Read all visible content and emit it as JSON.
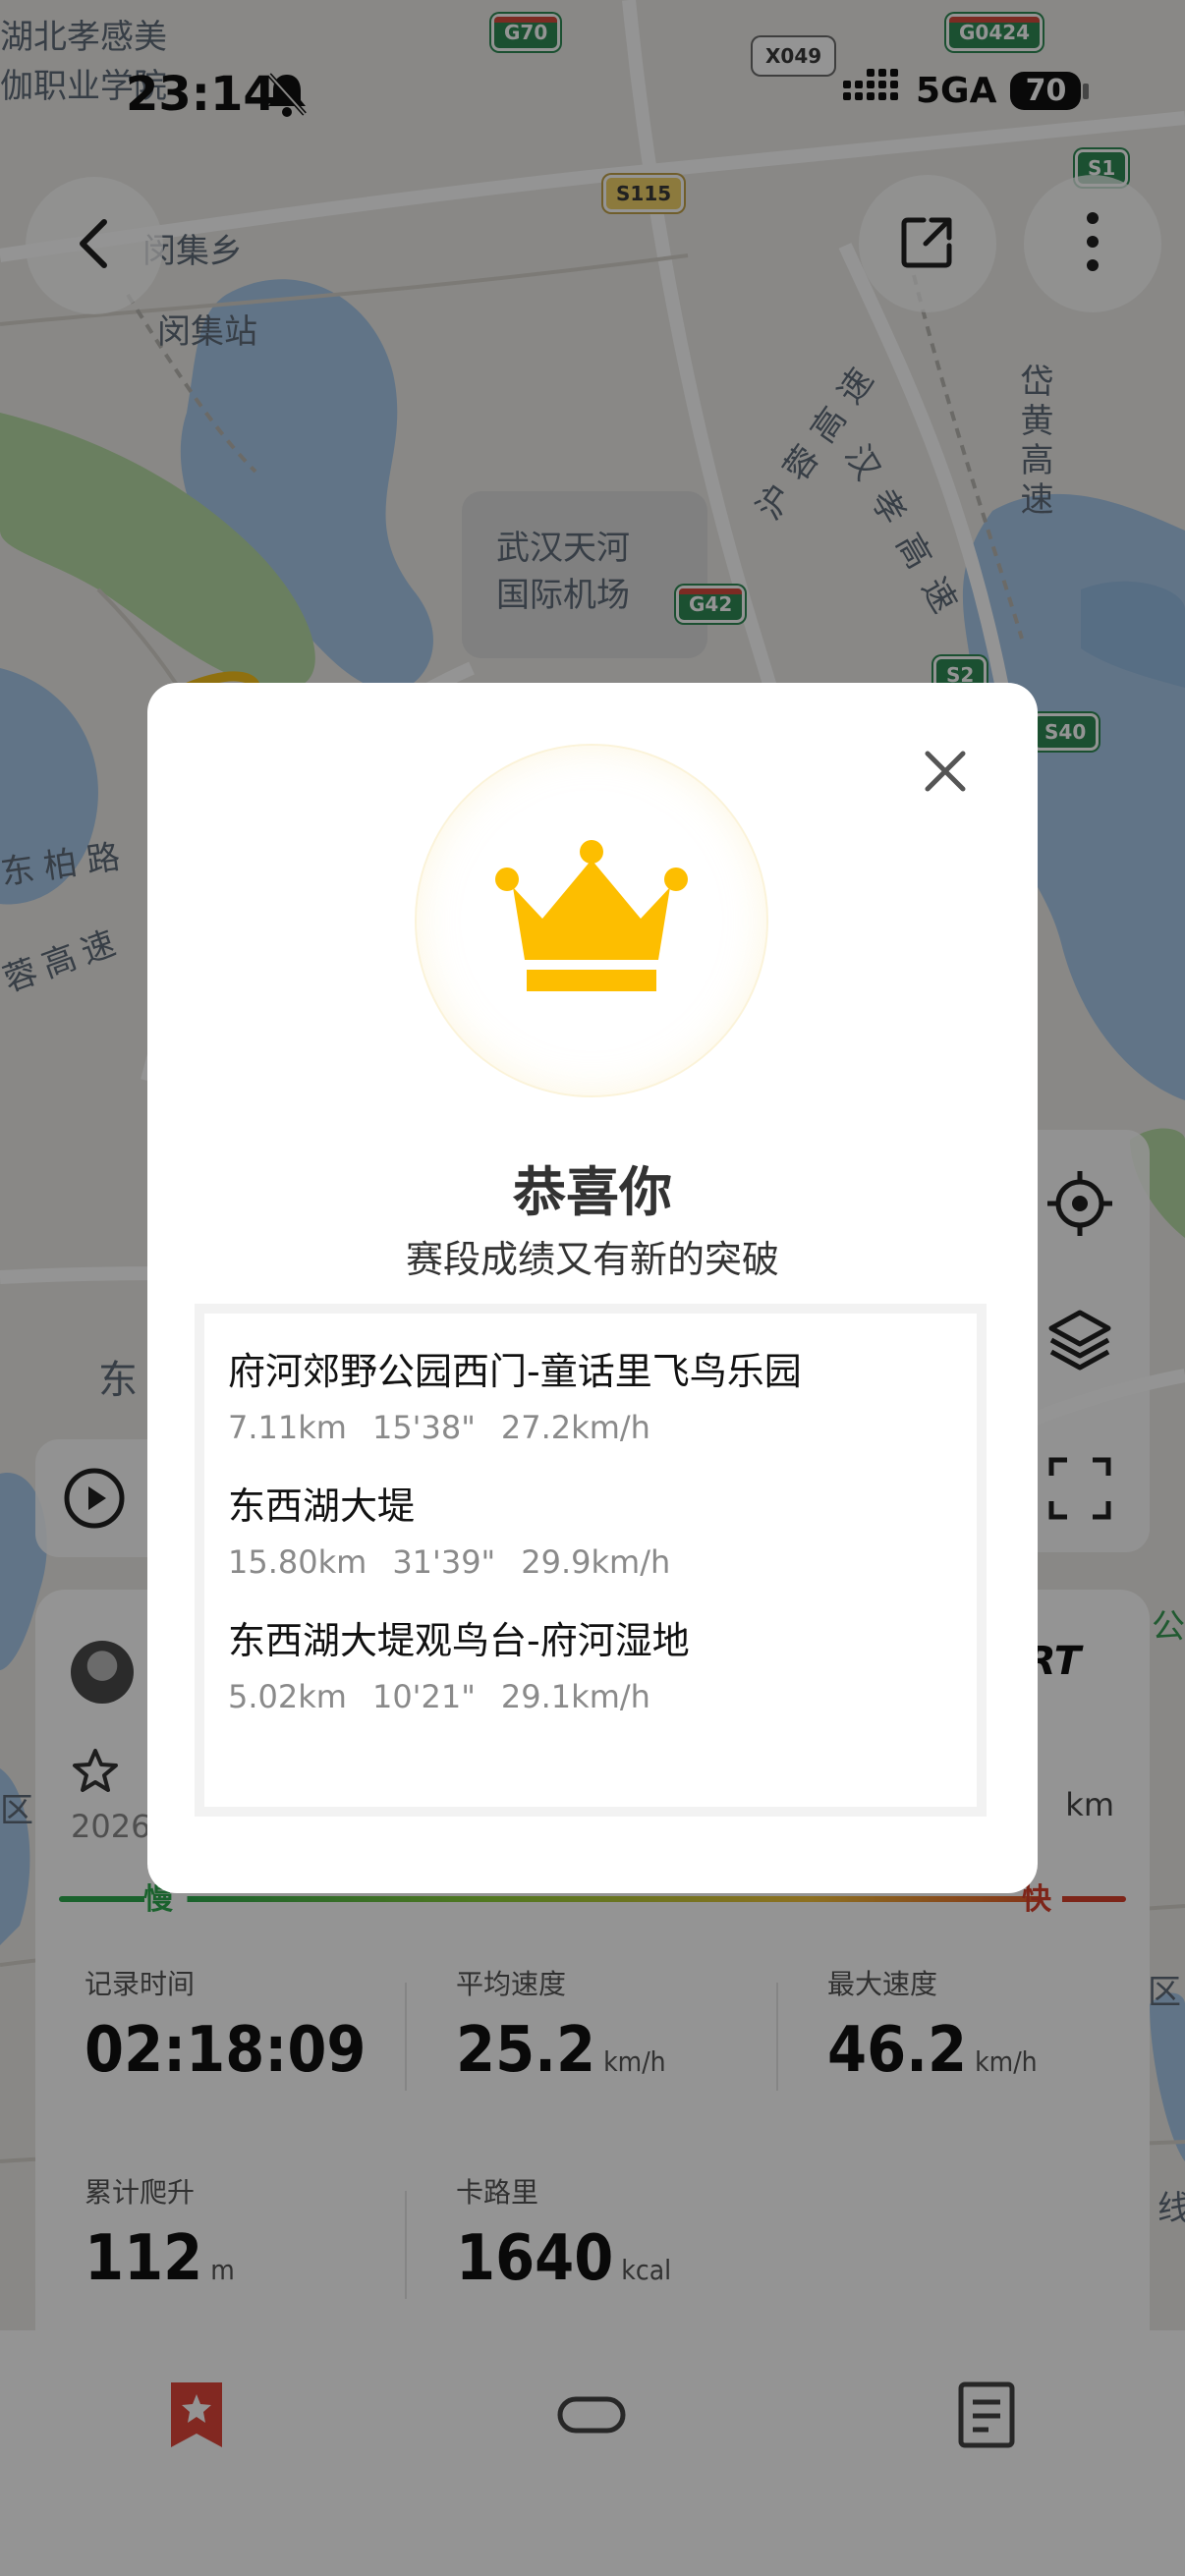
{
  "status_bar": {
    "time": "23:14",
    "network": "5GA",
    "battery": "70"
  },
  "map": {
    "labels": {
      "top_left_1": "湖北孝感美",
      "top_left_2": "伽职业学院",
      "township": "闵集乡",
      "station": "闵集站",
      "airport_1": "武汉天河",
      "airport_2": "国际机场",
      "road_1": "东柏路",
      "road_2": "蓉高速",
      "expressway_a": "沪蓉高速",
      "expressway_b": "汉孝高速",
      "expressway_c": "岱黄高速",
      "east_fragment": "东",
      "district_left": "区",
      "district_right": "区",
      "line_right": "线",
      "gong_right": "公"
    },
    "shields": {
      "g70": "G70",
      "x049": "X049",
      "g0424": "G0424",
      "s1": "S1",
      "s115": "S115",
      "g42": "G42",
      "s2": "S2",
      "s40": "S40"
    }
  },
  "sheet": {
    "brand": "RT",
    "distance_unit": "km",
    "date_partial": "2026",
    "speed_slow": "慢",
    "speed_fast": "快",
    "stats": [
      {
        "label": "记录时间",
        "value": "02:18:09",
        "unit": ""
      },
      {
        "label": "平均速度",
        "value": "25.2",
        "unit": "km/h"
      },
      {
        "label": "最大速度",
        "value": "46.2",
        "unit": "km/h"
      },
      {
        "label": "累计爬升",
        "value": "112",
        "unit": "m"
      },
      {
        "label": "卡路里",
        "value": "1640",
        "unit": "kcal"
      }
    ]
  },
  "modal": {
    "title": "恭喜你",
    "subtitle": "赛段成绩又有新的突破",
    "segments": [
      {
        "name": "府河郊野公园西门-童话里飞鸟乐园",
        "distance": "7.11km",
        "time": "15'38\"",
        "speed": "27.2km/h"
      },
      {
        "name": "东西湖大堤",
        "distance": "15.80km",
        "time": "31'39\"",
        "speed": "29.9km/h"
      },
      {
        "name": "东西湖大堤观鸟台-府河湿地",
        "distance": "5.02km",
        "time": "10'21\"",
        "speed": "29.1km/h"
      }
    ]
  },
  "colors": {
    "crown": "#FDBE00",
    "accent_red": "#E0453A",
    "slow_green": "#2EAA4F",
    "fast_red": "#D8402B"
  },
  "icons": {
    "back": "back-arrow-icon",
    "share": "share-icon",
    "more": "more-vertical-icon",
    "locate": "locate-icon",
    "layers": "layers-icon",
    "fullscreen": "fullscreen-icon",
    "play": "play-icon",
    "close": "close-icon",
    "crown": "crown-icon",
    "tab_record": "bookmark-star-icon",
    "tab_segments": "segment-icon",
    "tab_details": "document-icon"
  }
}
